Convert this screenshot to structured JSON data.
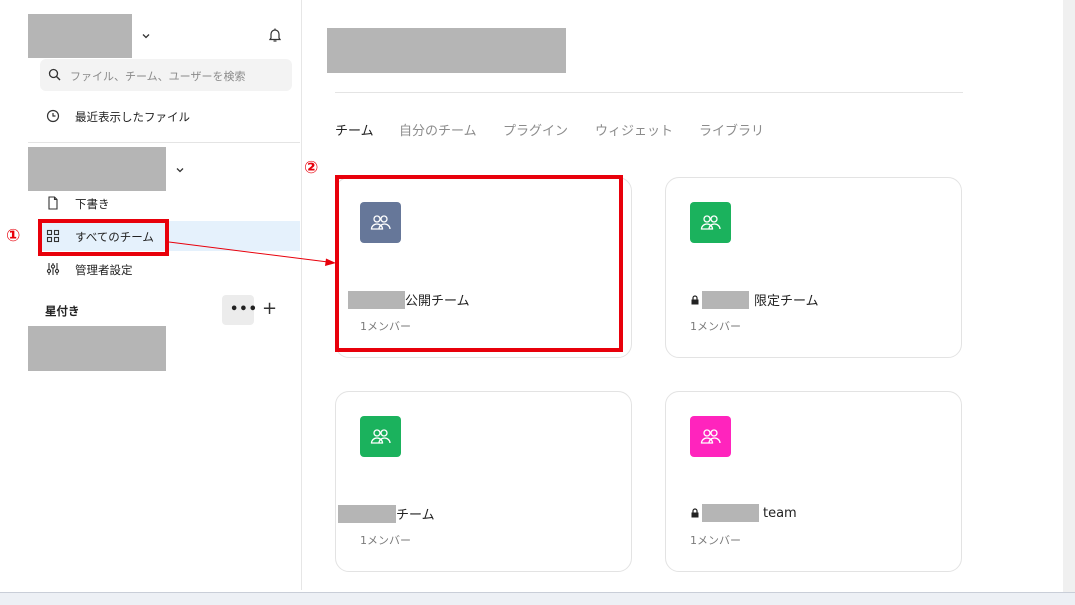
{
  "sidebar": {
    "search_placeholder": "ファイル、チーム、ユーザーを検索",
    "recent": "最近表示したファイル",
    "drafts": "下書き",
    "all_teams": "すべてのチーム",
    "admin_settings": "管理者設定",
    "favorites_title": "星付き",
    "more_label": "•••",
    "add_label": "+"
  },
  "tabs": [
    "チーム",
    "自分のチーム",
    "プラグイン",
    "ウィジェット",
    "ライブラリ"
  ],
  "cards": [
    {
      "name": "公開チーム",
      "members": "1メンバー",
      "color": "#667799",
      "locked": false
    },
    {
      "name": "限定チーム",
      "members": "1メンバー",
      "color": "#1bb25d",
      "locked": true
    },
    {
      "name": "チーム",
      "members": "1メンバー",
      "color": "#1bb25d",
      "locked": false
    },
    {
      "name": "team",
      "members": "1メンバー",
      "color": "#ff24bd",
      "locked": true
    }
  ],
  "annotations": {
    "step1": "①",
    "step2": "②",
    "color": "#e8000b"
  },
  "icons": [
    "chevron-down-icon",
    "bell-icon",
    "search-icon",
    "clock-icon",
    "document-icon",
    "grid-icon",
    "sliders-icon",
    "team-icon",
    "lock-icon"
  ]
}
